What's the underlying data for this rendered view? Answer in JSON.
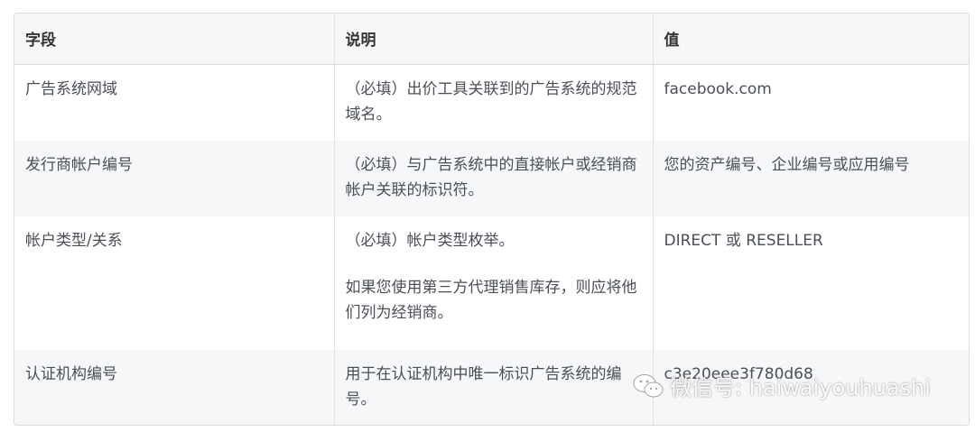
{
  "table": {
    "headers": [
      "字段",
      "说明",
      "值"
    ],
    "rows": [
      {
        "field": "广告系统网域",
        "desc": [
          "（必填）出价工具关联到的广告系统的规范域名。"
        ],
        "value": "facebook.com"
      },
      {
        "field": "发行商帐户编号",
        "desc": [
          "（必填）与广告系统中的直接帐户或经销商帐户关联的标识符。"
        ],
        "value": "您的资产编号、企业编号或应用编号"
      },
      {
        "field": "帐户类型/关系",
        "desc": [
          "（必填）帐户类型枚举。",
          "如果您使用第三方代理销售库存，则应将他们列为经销商。"
        ],
        "value": "DIRECT 或 RESELLER"
      },
      {
        "field": "认证机构编号",
        "desc": [
          "用于在认证机构中唯一标识广告系统的编号。"
        ],
        "value": "c3e20eee3f780d68"
      }
    ]
  },
  "watermark": {
    "text": "微信号: haiwaiyouhuashi",
    "icon": "wechat-icon"
  }
}
